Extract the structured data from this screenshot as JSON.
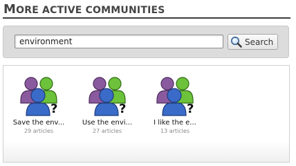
{
  "page": {
    "title_initial": "M",
    "title_rest": "ORE ACTIVE COMMUNITIES"
  },
  "search": {
    "value": "environment",
    "button_label": "Search",
    "icon": "magnifier-icon"
  },
  "communities": [
    {
      "name": "Save the env...",
      "count": "29 articles",
      "icon": "community-group-icon"
    },
    {
      "name": "Use the envi...",
      "count": "27 articles",
      "icon": "community-group-icon"
    },
    {
      "name": "I like the e...",
      "count": "13 articles",
      "icon": "community-group-icon"
    }
  ],
  "colors": {
    "title": "#444444",
    "rule": "#3d3d3d",
    "panel": "#dcdcdc",
    "person_purple": "#8a5a9e",
    "person_green": "#6cc23a",
    "person_blue": "#3a6bc8"
  }
}
